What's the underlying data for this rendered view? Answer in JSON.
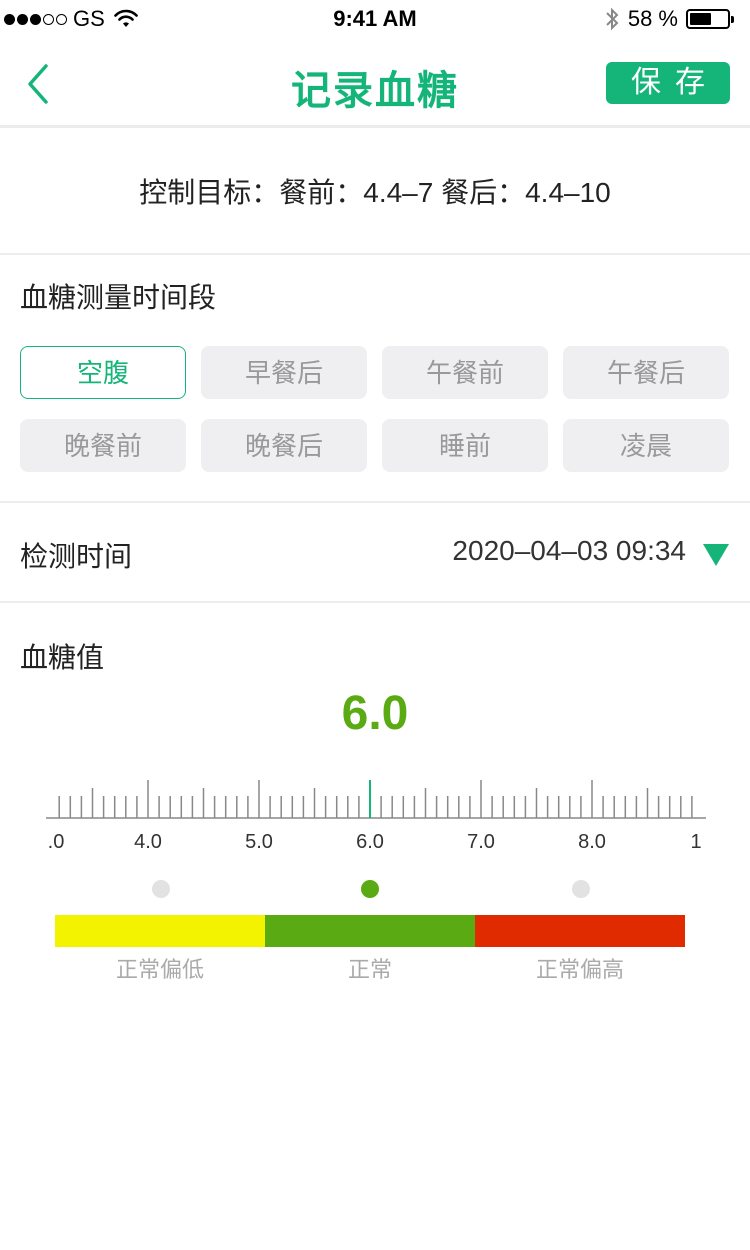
{
  "status_bar": {
    "carrier": "GS",
    "time": "9:41 AM",
    "battery_text": "58 %",
    "battery_level": 0.58,
    "icons": [
      "signal-dots-icon",
      "wifi-icon",
      "bluetooth-icon",
      "battery-icon"
    ]
  },
  "nav": {
    "title": "记录血糖",
    "save_label": "保存",
    "back_icon": "chevron-left-icon"
  },
  "target": {
    "text": "控制目标：餐前：4.4–7 餐后：4.4–10"
  },
  "period": {
    "title": "血糖测量时间段",
    "options": [
      "空腹",
      "早餐后",
      "午餐前",
      "午餐后",
      "晚餐前",
      "晚餐后",
      "睡前",
      "凌晨"
    ],
    "selected": "空腹"
  },
  "detect": {
    "label": "检测时间",
    "value": "2020–04–03 09:34",
    "icon": "triangle-down-icon"
  },
  "glucose": {
    "title": "血糖值",
    "value": "6.0",
    "value_number": 6.0,
    "ruler_labels": [
      ".0",
      "4.0",
      "5.0",
      "6.0",
      "7.0",
      "8.0",
      "1"
    ],
    "range_labels": [
      "正常偏低",
      "正常",
      "正常偏高"
    ],
    "active_range_index": 1,
    "colors": {
      "low": "#f3f300",
      "normal": "#5aaa13",
      "high": "#e02b00",
      "accent": "#15b57a",
      "indicator": "#15b57a",
      "inactive_dot": "#e2e2e2"
    }
  }
}
